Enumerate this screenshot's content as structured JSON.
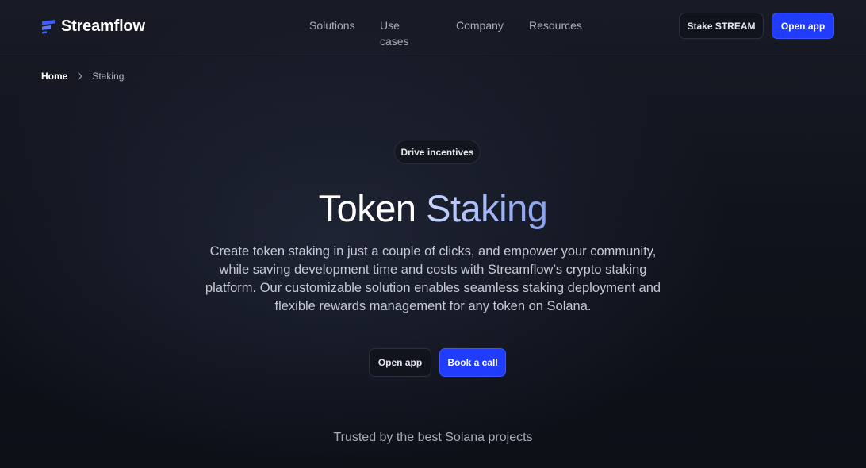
{
  "header": {
    "brand": "Streamflow",
    "nav": [
      "Solutions",
      "Use cases",
      "Company",
      "Resources"
    ],
    "stake_label": "Stake STREAM",
    "open_app_label": "Open app"
  },
  "breadcrumb": {
    "home": "Home",
    "current": "Staking"
  },
  "hero": {
    "badge": "Drive incentives",
    "title_part1": "Token",
    "title_part2": "Staking",
    "description": "Create token staking in just a couple of clicks, and empower your community, while saving development time and costs with Streamflow’s crypto staking platform. Our customizable solution enables seamless staking deployment and flexible rewards management for any token on Solana.",
    "open_app_label": "Open app",
    "book_call_label": "Book a call"
  },
  "trusted_text": "Trusted by the best Solana projects",
  "colors": {
    "primary": "#1f3cff",
    "background": "#11131c",
    "title_gradient": "#9fb3f5"
  },
  "icons": {
    "logo": "streamflow-logo-icon",
    "breadcrumb_separator": "chevron-right-icon"
  }
}
